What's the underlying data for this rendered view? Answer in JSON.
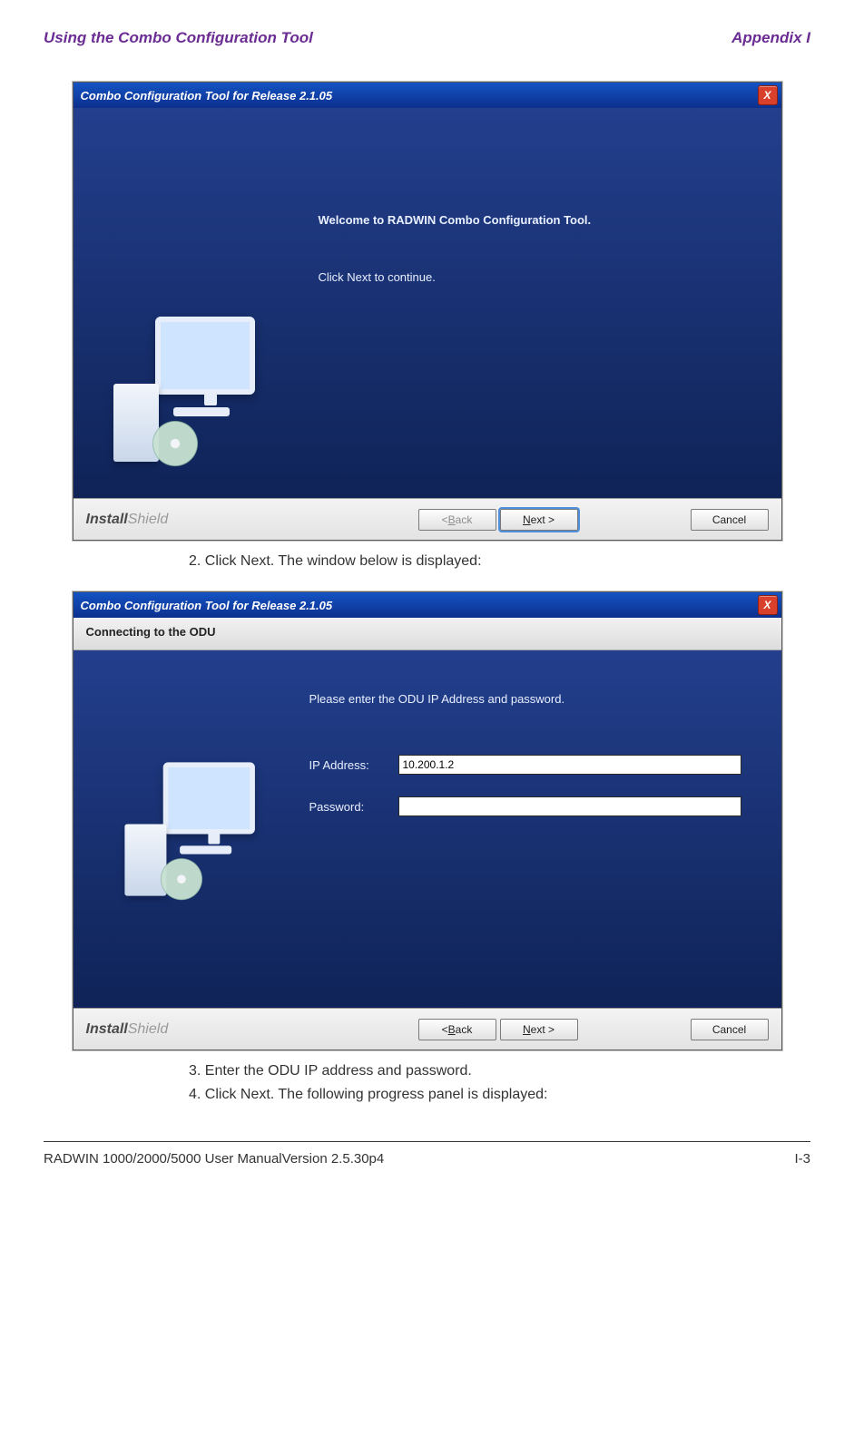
{
  "header": {
    "left": "Using the Combo Configuration Tool",
    "right": "Appendix I"
  },
  "wizard_common": {
    "title": "Combo Configuration Tool for Release 2.1.05",
    "close_x": "X",
    "install_brand_a": "Install",
    "install_brand_b": "Shield",
    "btn_back_label": "< Back",
    "btn_back_underline": "B",
    "btn_next_label": "Next >",
    "btn_next_underline": "N",
    "btn_cancel_label": "Cancel"
  },
  "wizard_welcome": {
    "msg1": "Welcome to RADWIN Combo Configuration Tool.",
    "msg2": "Click Next to continue."
  },
  "wizard_connect": {
    "subhead": "Connecting to the ODU",
    "prompt": "Please enter the ODU IP Address and password.",
    "ip_label": "IP Address:",
    "ip_value": "10.200.1.2",
    "pw_label": "Password:",
    "pw_value": ""
  },
  "steps": {
    "s2": "2. Click Next. The window below is displayed:",
    "s3": "3. Enter the ODU IP address and password.",
    "s4": "4. Click Next. The following progress panel is displayed:"
  },
  "footer": {
    "left": "RADWIN 1000/2000/5000 User ManualVersion  2.5.30p4",
    "right": "I-3"
  }
}
